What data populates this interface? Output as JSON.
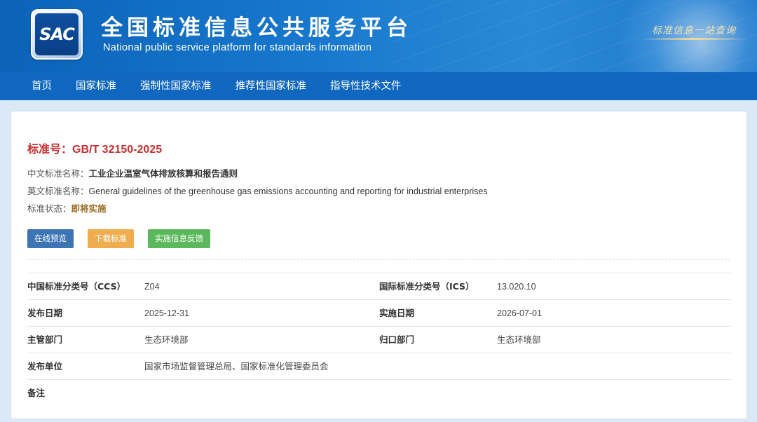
{
  "header": {
    "logo_text": "SAC",
    "title": "全国标准信息公共服务平台",
    "subtitle": "National public service platform  for standards information",
    "slogan": "标准信息一站查询"
  },
  "nav": {
    "items": [
      {
        "label": "首页"
      },
      {
        "label": "国家标准"
      },
      {
        "label": "强制性国家标准"
      },
      {
        "label": "推荐性国家标准"
      },
      {
        "label": "指导性技术文件"
      }
    ]
  },
  "standard": {
    "number_label": "标准号：",
    "number": "GB/T 32150-2025",
    "cn_name_label": "中文标准名称：",
    "cn_name": "工业企业温室气体排放核算和报告通则",
    "en_name_label": "英文标准名称：",
    "en_name": "General guidelines of the greenhouse gas emissions accounting and reporting for industrial enterprises",
    "status_label": "标准状态：",
    "status": "即将实施"
  },
  "actions": {
    "preview": "在线预览",
    "download": "下载标准",
    "feedback": "实施信息反馈"
  },
  "details": {
    "rows": [
      {
        "k1": "中国标准分类号（CCS）",
        "v1": "Z04",
        "k2": "国际标准分类号（ICS）",
        "v2": "13.020.10"
      },
      {
        "k1": "发布日期",
        "v1": "2025-12-31",
        "k2": "实施日期",
        "v2": "2026-07-01"
      },
      {
        "k1": "主管部门",
        "v1": "生态环境部",
        "k2": "归口部门",
        "v2": "生态环境部"
      },
      {
        "k1": "发布单位",
        "v1": "国家市场监督管理总局、国家标准化管理委员会",
        "k2": "",
        "v2": ""
      },
      {
        "k1": "备注",
        "v1": "",
        "k2": "",
        "v2": ""
      }
    ]
  },
  "colors": {
    "header_blue": "#1777cc",
    "nav_blue": "#1067bf",
    "standard_number_red": "#c62f2f",
    "status_brown": "#9c6b1f",
    "btn_preview": "#3d74b3",
    "btn_download": "#f0ad4e",
    "btn_feedback": "#5cb85c"
  }
}
